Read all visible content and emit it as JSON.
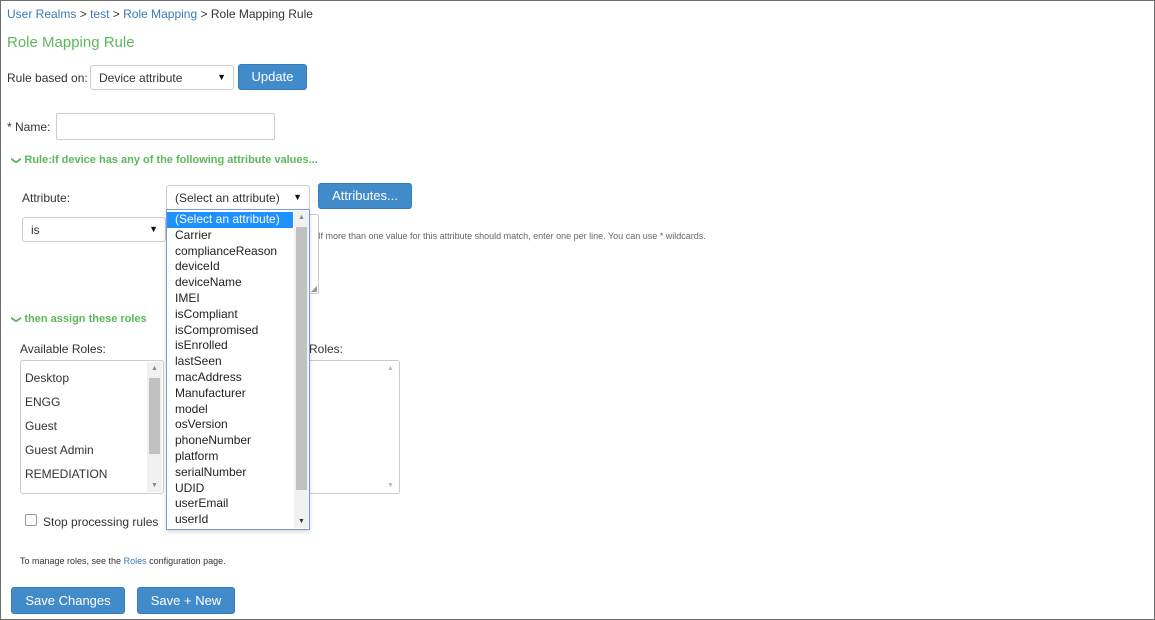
{
  "breadcrumb": {
    "items": [
      "User Realms",
      "test",
      "Role Mapping"
    ],
    "separator": ">",
    "current": "Role Mapping Rule"
  },
  "page_title": "Role Mapping Rule",
  "rule_based_on": {
    "label": "Rule based on:",
    "value": "Device attribute",
    "update_label": "Update"
  },
  "name": {
    "label": "* Name:",
    "value": ""
  },
  "rule_section": {
    "heading": "Rule:If device has any of the following attribute values...",
    "attribute_label": "Attribute:",
    "attribute_value": "(Select an attribute)",
    "attributes_button": "Attributes...",
    "operator_value": "is",
    "values_hint": "If more than one value for this attribute should match, enter one per line. You can use * wildcards."
  },
  "attribute_dropdown": {
    "options": [
      "(Select an attribute)",
      "Carrier",
      "complianceReason",
      "deviceId",
      "deviceName",
      "IMEI",
      "isCompliant",
      "isCompromised",
      "isEnrolled",
      "lastSeen",
      "macAddress",
      "Manufacturer",
      "model",
      "osVersion",
      "phoneNumber",
      "platform",
      "serialNumber",
      "UDID",
      "userEmail",
      "userId"
    ],
    "selected": "(Select an attribute)"
  },
  "assign_section": {
    "heading": "then assign these roles",
    "available_label": "Available Roles:",
    "selected_label": "Roles:",
    "available_roles": [
      "Desktop",
      "ENGG",
      "Guest",
      "Guest Admin",
      "REMEDIATION"
    ],
    "selected_roles": []
  },
  "stop_processing": {
    "label": "Stop processing rules",
    "checked": false
  },
  "footer": {
    "note_prefix": "To manage roles, see the",
    "roles_link": "Roles",
    "note_suffix": "configuration page."
  },
  "actions": {
    "save_changes": "Save Changes",
    "save_new": "Save + New"
  },
  "colors": {
    "accent_green": "#5cb85c",
    "button_blue": "#428bca",
    "link_blue": "#3a7ab8",
    "selection_blue": "#1e90ff"
  },
  "icons": {
    "section_toggle": "chevron-down-icon",
    "select_caret": "caret-down-icon",
    "scroll_up": "arrow-up-icon",
    "scroll_down": "arrow-down-icon"
  }
}
